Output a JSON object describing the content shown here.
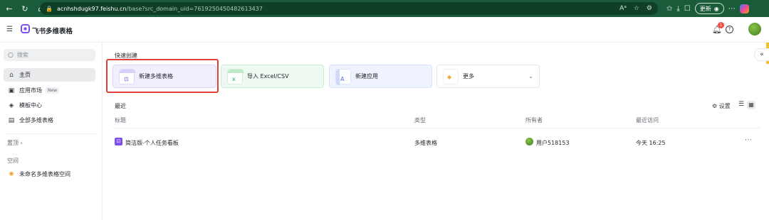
{
  "browser": {
    "url_host": "acnhshdugk97.feishu.cn",
    "url_rest": "/base?src_domain_uid=7619250450482613437",
    "update_label": "更新"
  },
  "app": {
    "title": "飞书多维表格",
    "notification_count": "1"
  },
  "sidebar": {
    "search_placeholder": "搜索",
    "items": [
      {
        "label": "主页",
        "icon": "home-icon"
      },
      {
        "label": "应用市场",
        "icon": "store-icon",
        "badge": "New"
      },
      {
        "label": "模板中心",
        "icon": "template-icon"
      },
      {
        "label": "全部多维表格",
        "icon": "table-icon"
      }
    ],
    "pinned_label": "置顶",
    "space_label": "空间",
    "space_item": "未命名多维表格空间"
  },
  "main": {
    "quick_create_title": "快速创建",
    "cards": [
      {
        "label": "新建多维表格"
      },
      {
        "label": "导入 Excel/CSV"
      },
      {
        "label": "新建应用"
      },
      {
        "label": "更多"
      }
    ],
    "recent_title": "最近",
    "settings_label": "设置",
    "columns": [
      "标题",
      "类型",
      "所有者",
      "最近访问"
    ],
    "rows": [
      {
        "title": "简洁版-个人任务看板",
        "type": "多维表格",
        "owner": "用户518153",
        "last_visit": "今天 16:25"
      }
    ]
  }
}
